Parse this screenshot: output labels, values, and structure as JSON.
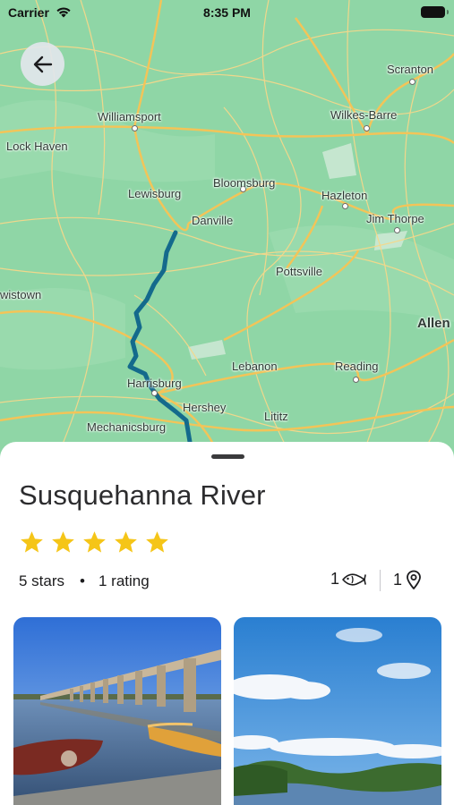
{
  "status_bar": {
    "carrier": "Carrier",
    "time": "8:35 PM"
  },
  "map": {
    "labels": {
      "scranton": "Scranton",
      "williamsport": "Williamsport",
      "wilkes_barre": "Wilkes-Barre",
      "lock_haven": "Lock Haven",
      "lewisburg": "Lewisburg",
      "bloomsburg": "Bloomsburg",
      "hazleton": "Hazleton",
      "danville": "Danville",
      "jim_thorpe": "Jim Thorpe",
      "pottsville": "Pottsville",
      "lewistown": "wistown",
      "allentown": "Allen",
      "lebanon": "Lebanon",
      "reading": "Reading",
      "harrisburg": "Harrisburg",
      "hershey": "Hershey",
      "lititz": "Lititz",
      "mechanicsburg": "Mechanicsburg"
    },
    "colors": {
      "land": "#8fd6a6",
      "road": "#f3c458",
      "river_route": "#146a8c"
    }
  },
  "back_button": {
    "icon": "arrow-left-icon"
  },
  "location": {
    "name": "Susquehanna River",
    "star_rating": 5,
    "stars_text": "5 stars",
    "separator": "•",
    "rating_count": "1 rating",
    "catch_count": "1",
    "catch_icon": "fish-icon",
    "spot_count": "1",
    "spot_icon": "map-pin-icon"
  },
  "photos": [
    {
      "subject": "stone arch bridge over river with boats at dock"
    },
    {
      "subject": "river valley with mountains and blue sky"
    }
  ],
  "colors": {
    "star": "#f5c518",
    "text": "#1c1c1e"
  }
}
